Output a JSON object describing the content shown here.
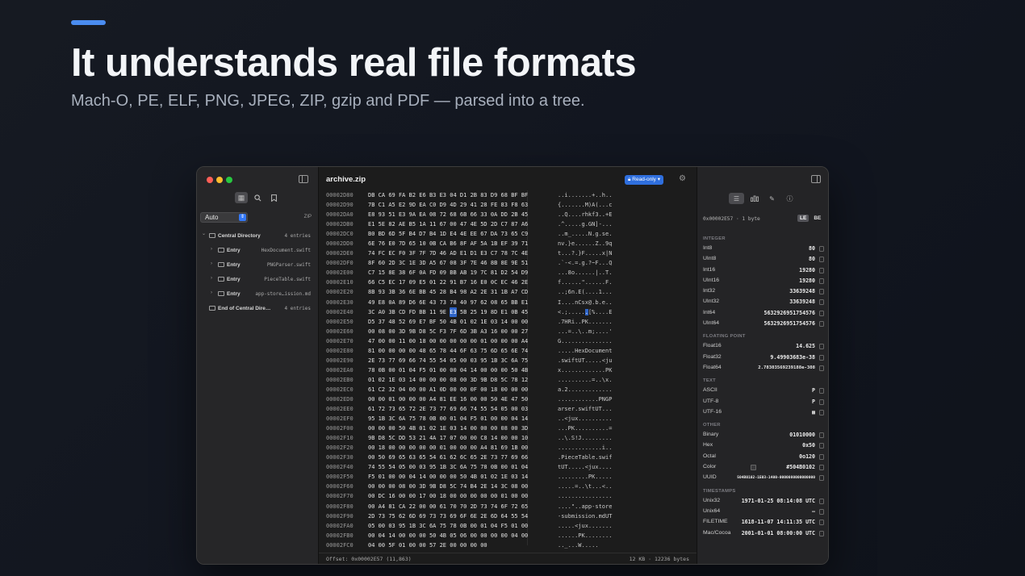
{
  "hero": {
    "title": "It understands real file formats",
    "subtitle": "Mach-O, PE, ELF, PNG, JPEG, ZIP, gzip and PDF — parsed into a tree."
  },
  "colors": {
    "accent": "#4a8cf0",
    "selection": "#2f65c8",
    "badge": "#2f6fde"
  },
  "sidebar": {
    "tools": [
      "grid-icon",
      "search-icon",
      "bookmark-icon"
    ],
    "format_select": "Auto",
    "format_detected": "ZIP",
    "tree": [
      {
        "name": "Central Directory",
        "value": "4 entries",
        "level": 0,
        "expanded": true
      },
      {
        "name": "Entry",
        "value": "HexDocument.swift",
        "level": 1,
        "expanded": false
      },
      {
        "name": "Entry",
        "value": "PNGParser.swift",
        "level": 1,
        "expanded": false
      },
      {
        "name": "Entry",
        "value": "PieceTable.swift",
        "level": 1,
        "expanded": false
      },
      {
        "name": "Entry",
        "value": "app-store…ission.md",
        "level": 1,
        "expanded": false
      },
      {
        "name": "End of Central Dire…",
        "value": "4 entries",
        "level": 0,
        "leaf": true
      }
    ]
  },
  "hex": {
    "filename": "archive.zip",
    "mode_badge": "Read-only",
    "selected_row": 12,
    "selected_byte": 8,
    "lines": [
      {
        "off": "00002D80",
        "bytes": "DB CA 69 FA B2 E6 B3 E3 04 D1 2B 83 D9 68 BF BF",
        "ascii": "..i.......+..h.."
      },
      {
        "off": "00002D90",
        "bytes": "7B C1 A5 E2 9D EA C0 D9 4D 29 41 28 FE 83 F8 63",
        "ascii": "{.......M)A(...c"
      },
      {
        "off": "00002DA0",
        "bytes": "E8 93 51 E3 9A EA 08 72 68 6B 66 33 0A DD 2B 45",
        "ascii": "..Q....rhkf3..+E"
      },
      {
        "off": "00002DB0",
        "bytes": "E1 5E 82 AE B5 1A 11 67 00 47 4E 5D 2D C7 87 A6",
        "ascii": ".^.....g.GN]-..."
      },
      {
        "off": "00002DC0",
        "bytes": "B0 BD 6D 5F B4 D7 B4 1D E4 4E EE 67 DA 73 65 C9",
        "ascii": "..m_.....N.g.se."
      },
      {
        "off": "00002DD0",
        "bytes": "6E 76 E0 7D 65 10 0B CA B6 8F AF 5A 1B EF 39 71",
        "ascii": "nv.}e......Z..9q"
      },
      {
        "off": "00002DE0",
        "bytes": "74 FC EC F0 3F 7F 7D 46 AD E1 D1 E3 C7 78 7C 4E",
        "ascii": "t...?.}F.....x|N"
      },
      {
        "off": "00002DF0",
        "bytes": "8F 60 2D 3C 1E 3D A5 67 08 3F 7E 46 8B 8E 9E 51",
        "ascii": ".`-<.=.g.?~F...Q"
      },
      {
        "off": "00002E00",
        "bytes": "C7 15 8E 38 6F 0A FD 09 BB AB 19 7C 81 D2 54 D9",
        "ascii": "...8o......|..T."
      },
      {
        "off": "00002E10",
        "bytes": "66 C5 EC 17 09 E5 01 22 91 B7 16 E0 0C EC 46 2E",
        "ascii": "f......\"......F."
      },
      {
        "off": "00002E20",
        "bytes": "8B 93 3B 36 6E BB 45 28 B4 98 A2 2E 31 1B A7 CD",
        "ascii": "..;6n.E(....1..."
      },
      {
        "off": "00002E30",
        "bytes": "49 E8 0A 89 D6 6E 43 73 78 40 97 62 08 65 BB E1",
        "ascii": "I....nCsx@.b.e.."
      },
      {
        "off": "00002E40",
        "bytes": "3C A0 3B CD FD BB 11 9E E3 5B 25 19 8D E1 0B 45",
        "ascii": "<.;......[%....E"
      },
      {
        "off": "00002E50",
        "bytes": "D5 37 48 52 69 E7 BF 50 4B 01 02 1E 03 14 00 00",
        "ascii": ".7HRi..PK......."
      },
      {
        "off": "00002E60",
        "bytes": "00 08 00 3D 9B D8 5C F3 7F 6D 3B A3 16 00 00 27",
        "ascii": "...=..\\..m;....'"
      },
      {
        "off": "00002E70",
        "bytes": "47 00 00 11 00 18 00 00 00 00 00 01 00 00 00 A4",
        "ascii": "G..............."
      },
      {
        "off": "00002E80",
        "bytes": "81 00 00 00 00 48 65 78 44 6F 63 75 6D 65 6E 74",
        "ascii": ".....HexDocument"
      },
      {
        "off": "00002E90",
        "bytes": "2E 73 77 69 66 74 55 54 05 00 03 95 1B 3C 6A 75",
        "ascii": ".swiftUT.....<ju"
      },
      {
        "off": "00002EA0",
        "bytes": "78 0B 00 01 04 F5 01 00 00 04 14 00 00 00 50 4B",
        "ascii": "x.............PK"
      },
      {
        "off": "00002EB0",
        "bytes": "01 02 1E 03 14 00 00 00 08 00 3D 9B D8 5C 78 12",
        "ascii": "..........=..\\x."
      },
      {
        "off": "00002EC0",
        "bytes": "61 C2 32 04 00 00 A1 0D 00 00 0F 00 18 00 00 00",
        "ascii": "a.2............."
      },
      {
        "off": "00002ED0",
        "bytes": "00 00 01 00 00 00 A4 81 EE 16 00 00 50 4E 47 50",
        "ascii": "............PNGP"
      },
      {
        "off": "00002EE0",
        "bytes": "61 72 73 65 72 2E 73 77 69 66 74 55 54 05 00 03",
        "ascii": "arser.swiftUT..."
      },
      {
        "off": "00002EF0",
        "bytes": "95 1B 3C 6A 75 78 0B 00 01 04 F5 01 00 00 04 14",
        "ascii": "..<jux.........."
      },
      {
        "off": "00002F00",
        "bytes": "00 00 00 50 4B 01 02 1E 03 14 00 00 00 08 00 3D",
        "ascii": "...PK..........="
      },
      {
        "off": "00002F10",
        "bytes": "9B D8 5C DD 53 21 4A 17 07 00 00 C8 14 00 00 10",
        "ascii": "..\\.S!J........."
      },
      {
        "off": "00002F20",
        "bytes": "00 18 00 00 00 00 00 01 00 00 00 A4 81 69 1B 00",
        "ascii": ".............i.."
      },
      {
        "off": "00002F30",
        "bytes": "00 50 69 65 63 65 54 61 62 6C 65 2E 73 77 69 66",
        "ascii": ".PieceTable.swif"
      },
      {
        "off": "00002F40",
        "bytes": "74 55 54 05 00 03 95 1B 3C 6A 75 78 0B 00 01 04",
        "ascii": "tUT.....<jux...."
      },
      {
        "off": "00002F50",
        "bytes": "F5 01 00 00 04 14 00 00 00 50 4B 01 02 1E 03 14",
        "ascii": ".........PK....."
      },
      {
        "off": "00002F60",
        "bytes": "00 00 00 08 00 3D 9B D8 5C 74 B4 2E 14 3C 08 00",
        "ascii": ".....=..\\t...<.."
      },
      {
        "off": "00002F70",
        "bytes": "00 DC 16 00 00 17 00 18 00 00 00 00 00 01 00 00",
        "ascii": "................"
      },
      {
        "off": "00002F80",
        "bytes": "00 A4 81 CA 22 00 00 61 70 70 2D 73 74 6F 72 65",
        "ascii": "....\"..app-store"
      },
      {
        "off": "00002F90",
        "bytes": "2D 73 75 62 6D 69 73 73 69 6F 6E 2E 6D 64 55 54",
        "ascii": "-submission.mdUT"
      },
      {
        "off": "00002FA0",
        "bytes": "05 00 03 95 1B 3C 6A 75 78 0B 00 01 04 F5 01 00",
        "ascii": ".....<jux......."
      },
      {
        "off": "00002FB0",
        "bytes": "00 04 14 00 00 00 50 4B 05 06 00 00 00 00 04 00",
        "ascii": "......PK........"
      },
      {
        "off": "00002FC0",
        "bytes": "04 00 5F 01 00 00 57 2E 00 00 00 00",
        "ascii": ".._...W....."
      }
    ],
    "footer_offset": "Offset: 0x00002E57 (11,863)",
    "footer_size": "12 KB · 12236 bytes"
  },
  "inspector": {
    "tabs": [
      "list-icon",
      "chart-icon",
      "pen-icon",
      "info-icon"
    ],
    "header": "0x00002E57 · 1 byte",
    "endian": [
      "LE",
      "BE"
    ],
    "endian_selected": "LE",
    "sections": [
      {
        "title": "INTEGER",
        "rows": [
          {
            "k": "Int8",
            "v": "80"
          },
          {
            "k": "UInt8",
            "v": "80"
          },
          {
            "k": "Int16",
            "v": "19280"
          },
          {
            "k": "UInt16",
            "v": "19280"
          },
          {
            "k": "Int32",
            "v": "33639248"
          },
          {
            "k": "UInt32",
            "v": "33639248"
          },
          {
            "k": "Int64",
            "v": "5632926951754576"
          },
          {
            "k": "UInt64",
            "v": "5632926951754576"
          }
        ]
      },
      {
        "title": "FLOATING POINT",
        "rows": [
          {
            "k": "Float16",
            "v": "14.625"
          },
          {
            "k": "Float32",
            "v": "9.49903683e-38"
          },
          {
            "k": "Float64",
            "v": "2.78303569239188e-308",
            "size": "small"
          }
        ]
      },
      {
        "title": "TEXT",
        "rows": [
          {
            "k": "ASCII",
            "v": "P"
          },
          {
            "k": "UTF-8",
            "v": "P"
          },
          {
            "k": "UTF-16",
            "v": "▩"
          }
        ]
      },
      {
        "title": "OTHER",
        "rows": [
          {
            "k": "Binary",
            "v": "01010000"
          },
          {
            "k": "Hex",
            "v": "0x50"
          },
          {
            "k": "Octal",
            "v": "0o120"
          },
          {
            "k": "Color",
            "v": "#504B0102",
            "swatch": true
          },
          {
            "k": "UUID",
            "v": "504B0102-1E03-1400-0000080000000000",
            "size": "tiny"
          }
        ]
      },
      {
        "title": "TIMESTAMPS",
        "rows": [
          {
            "k": "Unix32",
            "v": "1971-01-25 08:14:08 UTC"
          },
          {
            "k": "Unix64",
            "v": "—"
          },
          {
            "k": "FILETIME",
            "v": "1618-11-07 14:11:35 UTC"
          },
          {
            "k": "Mac/Cocoa",
            "v": "2001-01-01 08:00:00 UTC"
          }
        ]
      }
    ]
  }
}
